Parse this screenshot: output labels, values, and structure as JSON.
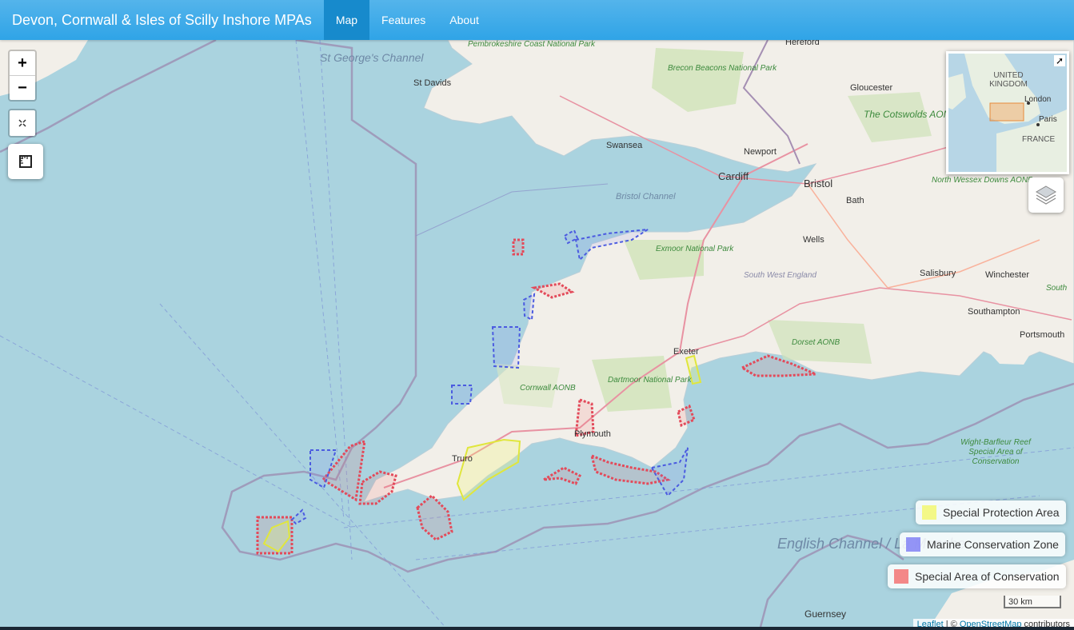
{
  "navbar": {
    "brand": "Devon, Cornwall & Isles of Scilly Inshore MPAs",
    "items": [
      {
        "label": "Map",
        "active": true
      },
      {
        "label": "Features",
        "active": false
      },
      {
        "label": "About",
        "active": false
      }
    ]
  },
  "controls": {
    "zoom_in": "+",
    "zoom_out": "−",
    "fullscreen_icon": "expand-icon",
    "measure_icon": "ruler-icon",
    "layers_icon": "layers-icon"
  },
  "minimap": {
    "labels": {
      "uk": "UNITED KINGDOM",
      "london": "London",
      "paris": "Paris",
      "france": "FRANCE"
    },
    "toggle_icon": "collapse-arrow-icon"
  },
  "legend": [
    {
      "label": "Special Protection Area",
      "color": "#f3f86a"
    },
    {
      "label": "Marine Conservation Zone",
      "color": "#7b7bf5"
    },
    {
      "label": "Special Area of Conservation",
      "color": "#f26b6b"
    }
  ],
  "map_labels": {
    "places": [
      "Hereford",
      "St Davids",
      "Gloucester",
      "Swansea",
      "Newport",
      "Cardiff",
      "Bristol",
      "Bath",
      "Wells",
      "Salisbury",
      "Winchester",
      "Southampton",
      "Portsmouth",
      "Exeter",
      "Truro",
      "Plymouth",
      "Guernsey"
    ],
    "seas": [
      "St George's Channel",
      "Bristol Channel",
      "English Channel / La Manche"
    ],
    "parks": [
      "Pembrokeshire Coast National Park",
      "Brecon Beacons National Park",
      "The Cotswolds AONB",
      "North Wessex Downs AONB",
      "Exmoor National Park",
      "South West England",
      "Dorset AONB",
      "Dartmoor National Park",
      "Cornwall AONB",
      "Wight-Barfleur Reef Special Area of Conservation",
      "South"
    ]
  },
  "scale": "30 km",
  "attribution": {
    "leaflet": "Leaflet",
    "sep": " | © ",
    "osm": "OpenStreetMap",
    "tail": " contributors"
  }
}
